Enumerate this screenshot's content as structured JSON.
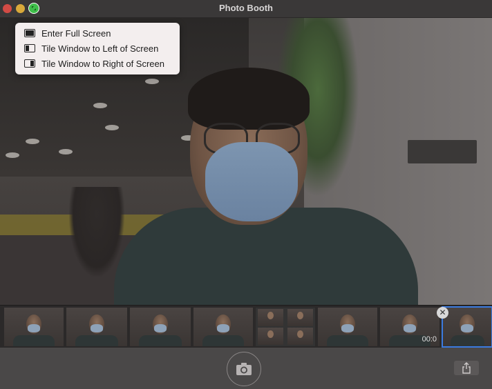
{
  "window": {
    "title": "Photo Booth"
  },
  "menu": {
    "items": [
      {
        "label": "Enter Full Screen",
        "icon": "full-screen-icon"
      },
      {
        "label": "Tile Window to Left of Screen",
        "icon": "tile-left-icon"
      },
      {
        "label": "Tile Window to Right of Screen",
        "icon": "tile-right-icon"
      }
    ]
  },
  "filmstrip": {
    "video_time": "00:0",
    "selected_index": 7
  },
  "toolbar": {
    "shutter_icon": "camera-icon",
    "share_icon": "share-icon"
  },
  "colors": {
    "menu_bg": "#f3eeee",
    "zoom_button": "#3fbf4a",
    "close_button": "#d24b45",
    "minimize_button": "#d9a93a",
    "selection": "#3b7be0"
  }
}
